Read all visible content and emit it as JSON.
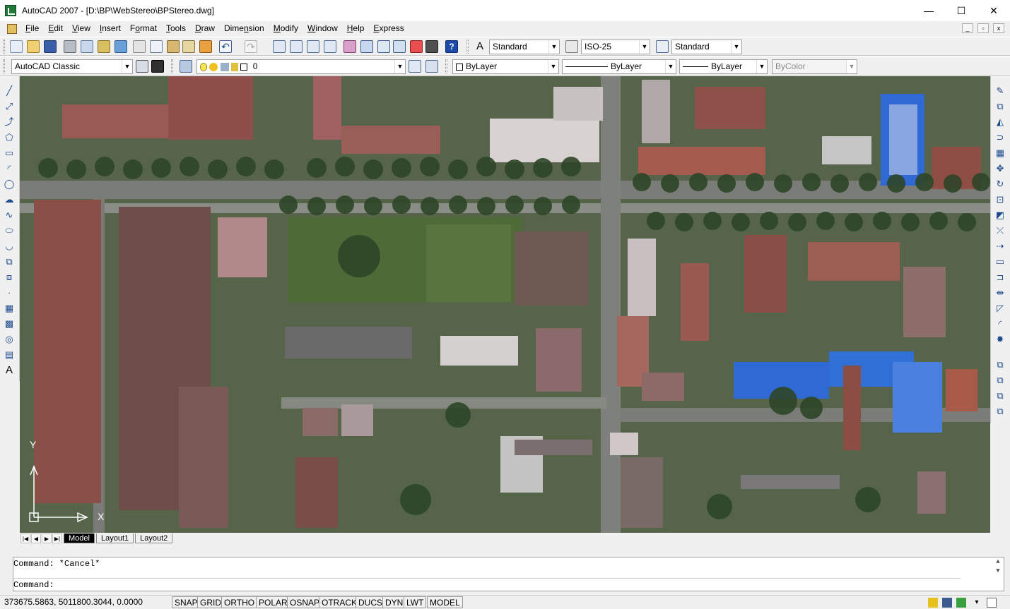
{
  "window": {
    "title": "AutoCAD 2007 - [D:\\BP\\WebStereo\\BPStereo.dwg]",
    "minimize": "—",
    "maximize": "☐",
    "close": "✕"
  },
  "menu": [
    {
      "pre": "",
      "u": "F",
      "post": "ile"
    },
    {
      "pre": "",
      "u": "E",
      "post": "dit"
    },
    {
      "pre": "",
      "u": "V",
      "post": "iew"
    },
    {
      "pre": "",
      "u": "I",
      "post": "nsert"
    },
    {
      "pre": "F",
      "u": "o",
      "post": "rmat"
    },
    {
      "pre": "",
      "u": "T",
      "post": "ools"
    },
    {
      "pre": "",
      "u": "D",
      "post": "raw"
    },
    {
      "pre": "Dime",
      "u": "n",
      "post": "sion"
    },
    {
      "pre": "",
      "u": "M",
      "post": "odify"
    },
    {
      "pre": "",
      "u": "W",
      "post": "indow"
    },
    {
      "pre": "",
      "u": "H",
      "post": "elp"
    },
    {
      "pre": "",
      "u": "E",
      "post": "xpress"
    }
  ],
  "styles": {
    "text_style": "Standard",
    "dim_style": "ISO-25",
    "table_style": "Standard"
  },
  "workspace": "AutoCAD Classic",
  "layer": "0",
  "properties": {
    "color": "ByLayer",
    "linetype": "ByLayer",
    "lineweight": "ByLayer",
    "plotstyle": "ByColor"
  },
  "tabs": [
    "Model",
    "Layout1",
    "Layout2"
  ],
  "ucs": {
    "y": "Y",
    "x": "X"
  },
  "command": {
    "history": "Command: *Cancel*",
    "prompt": "Command:"
  },
  "status": {
    "coords": "373675.5863, 5011800.3044, 0.0000",
    "buttons": [
      "SNAP",
      "GRID",
      "ORTHO",
      "POLAR",
      "OSNAP",
      "OTRACK",
      "DUCS",
      "DYN",
      "LWT",
      "MODEL"
    ]
  },
  "colors": {
    "drawing_bg": "#5d6a52",
    "roof_red": "#8a4a44",
    "roof_blue": "#2f6fd6",
    "road": "#7c7c7c",
    "grass": "#4f6a3a"
  }
}
